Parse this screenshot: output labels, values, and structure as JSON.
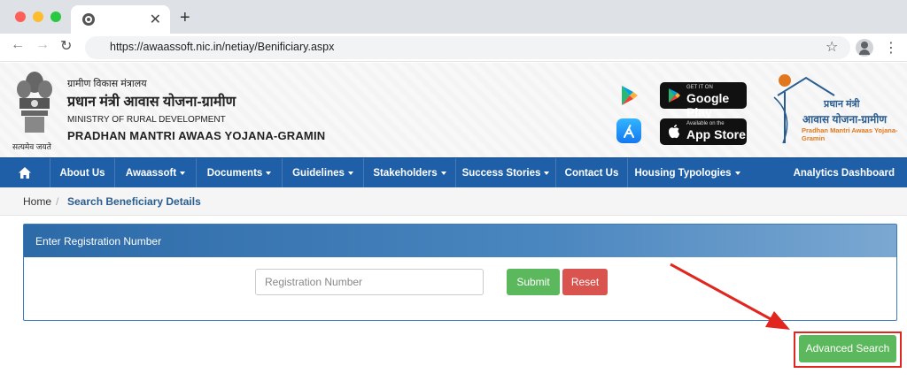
{
  "browser": {
    "tab_close": "✕",
    "new_tab": "+",
    "url": "https://awaassoft.nic.in/netiay/Benificiary.aspx",
    "icons": [
      "back-arrow-icon",
      "forward-arrow-icon",
      "reload-icon",
      "star-icon",
      "profile-icon",
      "kebab-menu-icon"
    ]
  },
  "header": {
    "emblem_caption": "सत्यमेव जयते",
    "ministry_hi": "ग्रामीण विकास मंत्रालय",
    "scheme_hi": "प्रधान मंत्री आवास योजना-ग्रामीण",
    "ministry_en": "MINISTRY OF RURAL DEVELOPMENT",
    "scheme_en": "PRADHAN MANTRI AWAAS YOJANA-GRAMIN",
    "google_play": {
      "small": "GET IT ON",
      "big": "Google Play"
    },
    "app_store": {
      "small": "Available on the",
      "big": "App Store"
    },
    "logo": {
      "line1": "प्रधान मंत्री",
      "line2": "आवास योजना-ग्रामीण",
      "line3": "Pradhan Mantri Awaas Yojana-Gramin"
    }
  },
  "nav": {
    "items": [
      {
        "label": "About Us",
        "dropdown": false
      },
      {
        "label": "Awaassoft",
        "dropdown": true
      },
      {
        "label": "Documents",
        "dropdown": true
      },
      {
        "label": "Guidelines",
        "dropdown": true
      },
      {
        "label": "Stakeholders",
        "dropdown": true
      },
      {
        "label": "Success Stories",
        "dropdown": true
      },
      {
        "label": "Contact Us",
        "dropdown": false
      },
      {
        "label": "Housing Typologies",
        "dropdown": true
      }
    ],
    "right": "Analytics Dashboard",
    "color": "#1f5fa8"
  },
  "breadcrumb": {
    "home": "Home",
    "separator": "/",
    "current": "Search Beneficiary Details"
  },
  "panel": {
    "title": "Enter Registration Number",
    "input_placeholder": "Registration Number",
    "input_value": "",
    "submit_label": "Submit",
    "reset_label": "Reset"
  },
  "advanced_search_label": "Advanced Search",
  "colors": {
    "success": "#5cb85c",
    "danger": "#d9534f",
    "highlight": "#e0261f"
  }
}
